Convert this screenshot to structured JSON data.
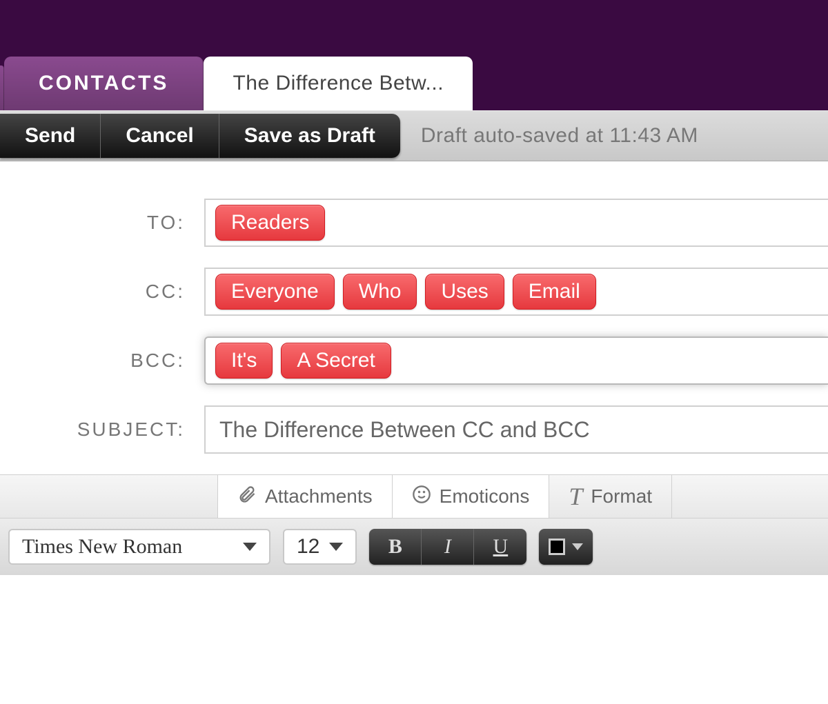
{
  "tabs": {
    "contacts": "CONTACTS",
    "compose": "The Difference Betw..."
  },
  "actions": {
    "send": "Send",
    "cancel": "Cancel",
    "save_draft": "Save as Draft",
    "status": "Draft auto-saved at 11:43 AM"
  },
  "fields": {
    "to_label": "TO:",
    "cc_label": "CC:",
    "bcc_label": "BCC:",
    "subject_label": "SUBJECT:",
    "to_chips": [
      "Readers"
    ],
    "cc_chips": [
      "Everyone",
      "Who",
      "Uses",
      "Email"
    ],
    "bcc_chips": [
      "It's",
      "A Secret"
    ],
    "subject_value": "The Difference Between CC and BCC"
  },
  "sub_tabs": {
    "attachments": "Attachments",
    "emoticons": "Emoticons",
    "format": "Format"
  },
  "format": {
    "font_family": "Times New Roman",
    "font_size": "12",
    "bold": "B",
    "italic": "I",
    "underline": "U"
  }
}
